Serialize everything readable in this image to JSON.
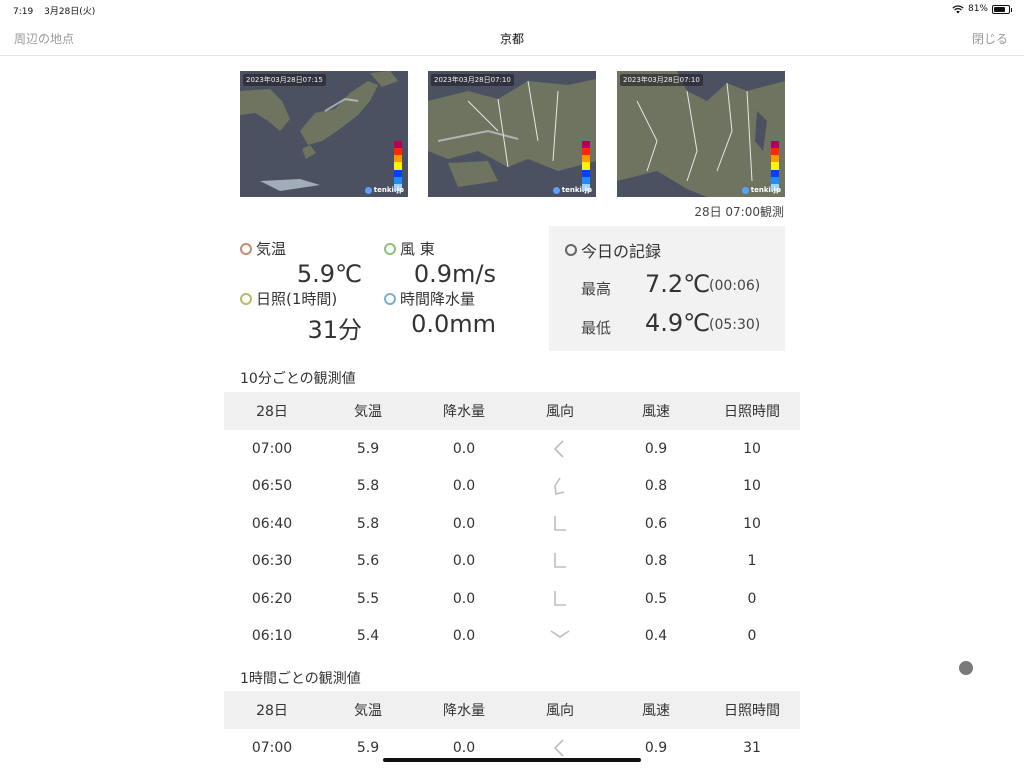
{
  "status_bar": {
    "time": "7:19",
    "date": "3月28日(火)",
    "battery": "81%",
    "battery_level": 0.81
  },
  "nav": {
    "left": "周辺の地点",
    "title": "京都",
    "right": "閉じる"
  },
  "maps": [
    {
      "timestamp": "2023年03月28日07:15",
      "logo": "tenki.jp"
    },
    {
      "timestamp": "2023年03月28日07:10",
      "logo": "tenki.jp"
    },
    {
      "timestamp": "2023年03月28日07:10",
      "logo": "tenki.jp"
    }
  ],
  "observation_time": "28日 07:00観測",
  "current": {
    "temp_label": "気温",
    "temp_value": "5.9℃",
    "wind_label": "風 東",
    "wind_value": "0.9m/s",
    "sun_label": "日照(1時間)",
    "sun_value": "31分",
    "rain_label": "時間降水量",
    "rain_value": "0.0mm"
  },
  "colors": {
    "temp": "#c98a6e",
    "wind": "#8fc07a",
    "sun": "#b8b86a",
    "rain": "#7ab0cc",
    "record": "#666666"
  },
  "record": {
    "title": "今日の記録",
    "high_label": "最高",
    "high_value": "7.2℃",
    "high_time": "(00:06)",
    "low_label": "最低",
    "low_value": "4.9℃",
    "low_time": "(05:30)"
  },
  "ten_min": {
    "title": "10分ごとの観測値",
    "headers": [
      "28日",
      "気温",
      "降水量",
      "風向",
      "風速",
      "日照時間"
    ],
    "rows": [
      {
        "time": "07:00",
        "temp": "5.9",
        "rain": "0.0",
        "wind_icon": "wind-arrow-east-icon",
        "speed": "0.9",
        "sun": "10"
      },
      {
        "time": "06:50",
        "temp": "5.8",
        "rain": "0.0",
        "wind_icon": "wind-arrow-northeast-icon",
        "speed": "0.8",
        "sun": "10"
      },
      {
        "time": "06:40",
        "temp": "5.8",
        "rain": "0.0",
        "wind_icon": "wind-arrow-north-icon",
        "speed": "0.6",
        "sun": "10"
      },
      {
        "time": "06:30",
        "temp": "5.6",
        "rain": "0.0",
        "wind_icon": "wind-arrow-north-icon",
        "speed": "0.8",
        "sun": "1"
      },
      {
        "time": "06:20",
        "temp": "5.5",
        "rain": "0.0",
        "wind_icon": "wind-arrow-north-icon",
        "speed": "0.5",
        "sun": "0"
      },
      {
        "time": "06:10",
        "temp": "5.4",
        "rain": "0.0",
        "wind_icon": "wind-arrow-south-icon",
        "speed": "0.4",
        "sun": "0"
      }
    ]
  },
  "hourly": {
    "title": "1時間ごとの観測値",
    "headers": [
      "28日",
      "気温",
      "降水量",
      "風向",
      "風速",
      "日照時間"
    ],
    "rows": [
      {
        "time": "07:00",
        "temp": "5.9",
        "rain": "0.0",
        "wind_icon": "wind-arrow-east-icon",
        "speed": "0.9",
        "sun": "31"
      }
    ]
  }
}
